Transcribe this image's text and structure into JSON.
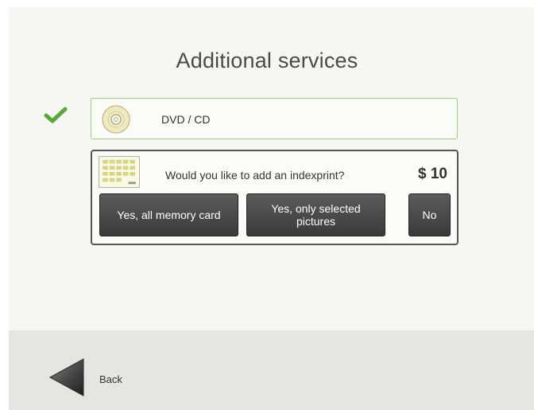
{
  "page": {
    "title": "Additional services"
  },
  "dvd_option": {
    "label": "DVD / CD",
    "selected": true,
    "check_icon": "check-icon",
    "disc_icon": "disc-icon"
  },
  "indexprint": {
    "question": "Would you like to add an indexprint?",
    "price": "$ 10",
    "thumbnail_icon": "indexprint-thumbnail-icon",
    "buttons": {
      "all_label": "Yes, all memory card",
      "selected_label": "Yes, only selected pictures",
      "no_label": "No"
    }
  },
  "footer": {
    "back_label": "Back",
    "back_icon": "back-arrow-icon"
  },
  "colors": {
    "accent_green": "#5aa63c",
    "background": "#f6f6f3",
    "footer_background": "#e6e5e1",
    "button_dark": "#444444"
  }
}
